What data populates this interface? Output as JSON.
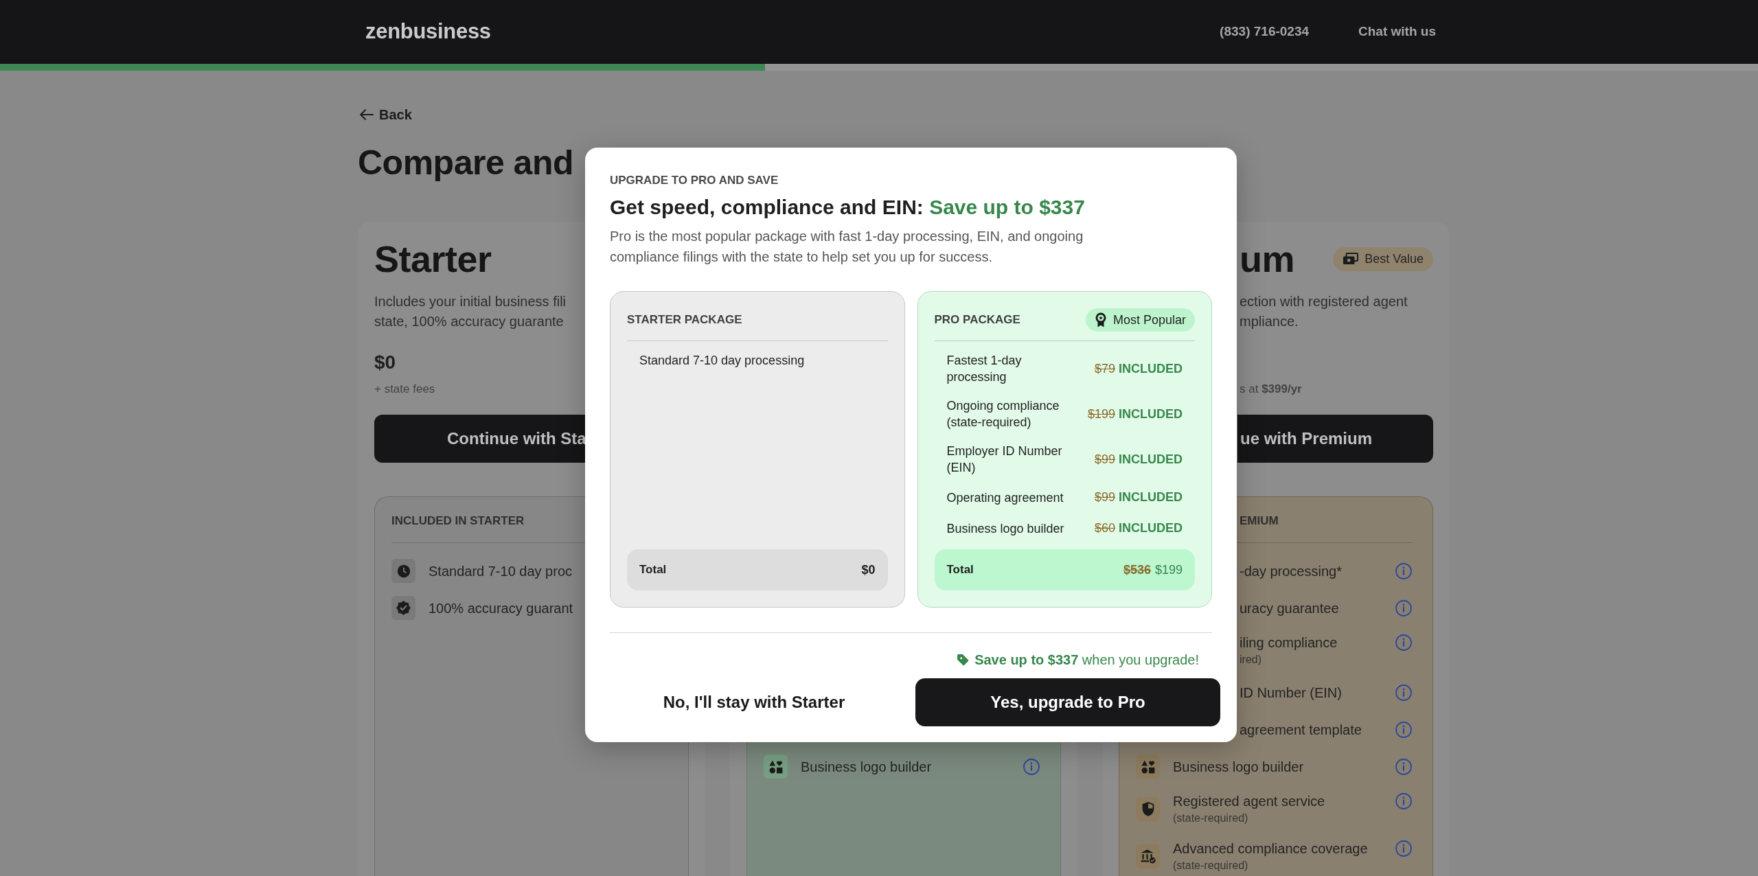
{
  "header": {
    "logo": "zenbusiness",
    "links": [
      "(833) 716-0234",
      "Chat with us"
    ]
  },
  "progress": {
    "level": 0.435
  },
  "back_link": "Back",
  "page_title": "Compare and",
  "starter_card": {
    "title": "Starter",
    "description_lines": [
      "Includes your initial business fili",
      "state, 100% accuracy guarante"
    ],
    "price": "$0",
    "price_note": "+ state fees",
    "button": "Continue with Sta",
    "included_heading": "INCLUDED IN STARTER",
    "features": [
      "Standard 7-10 day proc",
      "100% accuracy guarant"
    ]
  },
  "pro_card": {
    "features": [
      "Business logo builder"
    ]
  },
  "premium_card": {
    "title": "um",
    "tag": "Best Value",
    "description_lines": [
      "ection with registered agent",
      "mpliance."
    ],
    "price_note": "s at **$399/yr**",
    "button": "ue with Premium",
    "included_heading": "EMIUM",
    "features": [
      {
        "kind": "partial",
        "label": "-day processing*"
      },
      {
        "kind": "partial",
        "label": "uracy guarantee"
      },
      {
        "kind": "partial",
        "label": "iling compliance",
        "note": "ired)"
      },
      {
        "kind": "partial",
        "label": "ID Number (EIN)"
      },
      {
        "kind": "partial",
        "label": "agreement template"
      },
      {
        "kind": "full",
        "label": "Business logo builder"
      },
      {
        "kind": "full",
        "label": "Registered agent service",
        "note": "(state-required)"
      },
      {
        "kind": "full",
        "label": "Advanced compliance coverage",
        "note": "(state-required)"
      }
    ]
  },
  "modal": {
    "eyebrow": "UPGRADE TO PRO AND SAVE",
    "title": "Get speed, compliance and EIN:",
    "title_highlight": "Save up to $337",
    "description": "Pro is the most popular package with fast 1-day processing, EIN, and ongoing compliance filings with the state to help set you up for success.",
    "packages": [
      {
        "kind": "starter",
        "heading": "STARTER PACKAGE",
        "items": [
          {
            "label": "Standard 7-10 day processing"
          }
        ],
        "total": {
          "label": "Total",
          "price": "$0"
        }
      },
      {
        "kind": "pro",
        "heading": "PRO PACKAGE",
        "tag": "Most Popular",
        "items": [
          {
            "label": "Fastest 1-day processing",
            "old_price": "$79",
            "status": "INCLUDED"
          },
          {
            "label": "Ongoing compliance (state-required)",
            "old_price": "$199",
            "status": "INCLUDED"
          },
          {
            "label": "Employer ID Number (EIN)",
            "old_price": "$99",
            "status": "INCLUDED"
          },
          {
            "label": "Operating agreement",
            "old_price": "$99",
            "status": "INCLUDED"
          },
          {
            "label": "Business logo builder",
            "old_price": "$60",
            "status": "INCLUDED"
          }
        ],
        "total": {
          "label": "Total",
          "old_price": "$536",
          "price": "$199"
        }
      }
    ],
    "savings_note": "**Save up to $337** when you upgrade!",
    "buttons": [
      {
        "kind": "secondary",
        "label": "No, I'll stay with Starter"
      },
      {
        "kind": "primary",
        "label": "Yes, upgrade to Pro"
      }
    ]
  }
}
